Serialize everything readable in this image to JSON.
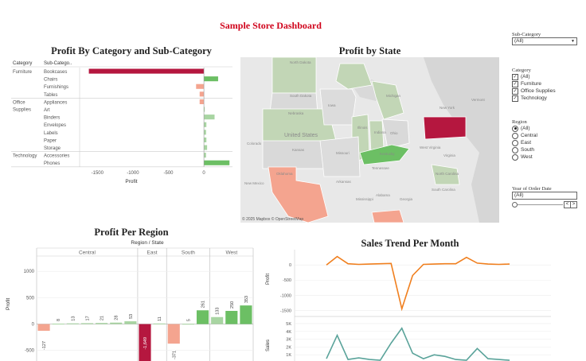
{
  "title": "Sample Store Dashboard",
  "colors": {
    "title": "#d0021b",
    "neg_dark": "#b5173f",
    "neg_light": "#f4a48f",
    "pos_light": "#a8d5a2",
    "pos_mid": "#6cbf64",
    "line_profit": "#f07f1e",
    "line_sales": "#5aa39a"
  },
  "category_chart": {
    "title": "Profit By Category and Sub-Category",
    "col_category": "Category",
    "col_subcategory": "Sub-Catego..",
    "x_axis_label": "Profit",
    "x_ticks": [
      "-1500",
      "-1000",
      "-500",
      "0"
    ],
    "groups": [
      {
        "category": "Furniture",
        "rows": [
          "Bookcases",
          "Chairs",
          "Furnishings",
          "Tables"
        ]
      },
      {
        "category": "Office Supplies",
        "rows": [
          "Appliances",
          "Art",
          "Binders",
          "Envelopes",
          "Labels",
          "Paper",
          "Storage"
        ]
      },
      {
        "category": "Technology",
        "rows": [
          "Accessories",
          "Phones"
        ]
      }
    ]
  },
  "chart_data": [
    {
      "type": "bar",
      "title": "Profit By Category and Sub-Category",
      "xlabel": "Profit",
      "xlim": [
        -1750,
        380
      ],
      "categories": [
        "Bookcases",
        "Chairs",
        "Furnishings",
        "Tables",
        "Appliances",
        "Art",
        "Binders",
        "Envelopes",
        "Labels",
        "Paper",
        "Storage",
        "Accessories",
        "Phones"
      ],
      "values": [
        -1620,
        200,
        -110,
        -60,
        -60,
        12,
        150,
        35,
        30,
        35,
        45,
        30,
        360
      ]
    },
    {
      "type": "bar",
      "title": "Profit Per Region",
      "xlabel": "Region / State",
      "ylabel": "Profit",
      "ylim": [
        -700,
        1350
      ],
      "regions": [
        "Central",
        "East",
        "South",
        "West"
      ],
      "values": [
        -127,
        8,
        13,
        17,
        21,
        28,
        53,
        -1649,
        11,
        -371,
        5,
        261,
        133,
        250,
        353
      ]
    },
    {
      "type": "line",
      "title": "Sales Trend Per Month",
      "series": [
        {
          "name": "Profit",
          "values": [
            0,
            280,
            40,
            20,
            30,
            40,
            50,
            -1450,
            -350,
            20,
            30,
            40,
            40,
            250,
            60,
            30,
            20,
            30
          ]
        },
        {
          "name": "Sales",
          "values": [
            500,
            3500,
            400,
            600,
            400,
            300,
            2500,
            4400,
            1200,
            500,
            1000,
            800,
            400,
            300,
            1800,
            500,
            400,
            300
          ]
        }
      ]
    }
  ],
  "map": {
    "title": "Profit by State",
    "attribution": "© 2025 Mapbox © OpenStreetMap",
    "labels": [
      "North Dakota",
      "South Dakota",
      "Iowa",
      "Nebraska",
      "United States",
      "Kansas",
      "Colorado",
      "Missouri",
      "Oklahoma",
      "Arkansas",
      "Tennessee",
      "Mississippi",
      "Alabama",
      "Georgia",
      "North Carolina",
      "South Carolina",
      "Virginia",
      "West Virginia",
      "Ohio",
      "New York",
      "Vermont",
      "Illinois",
      "Indiana",
      "Kentucky",
      "Michigan",
      "New Mexico"
    ]
  },
  "region_chart": {
    "title": "Profit Per Region",
    "header": "Region / State",
    "regions": [
      "Central",
      "East",
      "South",
      "West"
    ],
    "y_label": "Profit",
    "y_ticks": [
      "1000",
      "500",
      "0",
      "-500"
    ],
    "bar_labels": [
      "-127",
      "8",
      "13",
      "17",
      "21",
      "28",
      "53",
      "-1,649",
      "11",
      "-371",
      "5",
      "261",
      "133",
      "250",
      "353"
    ]
  },
  "trend_chart": {
    "title": "Sales Trend Per Month",
    "profit_label": "Profit",
    "sales_label": "Sales",
    "profit_ticks": [
      "0",
      "-500",
      "-1000",
      "-1500"
    ],
    "sales_ticks": [
      "5K",
      "4K",
      "3K",
      "2K",
      "1K"
    ]
  },
  "filters": {
    "subcategory": {
      "title": "Sub-Category",
      "value": "(All)"
    },
    "category": {
      "title": "Category",
      "options": [
        "(All)",
        "Furniture",
        "Office Supplies",
        "Technology"
      ]
    },
    "region": {
      "title": "Region",
      "options": [
        "(All)",
        "Central",
        "East",
        "South",
        "West"
      ],
      "selected": "(All)"
    },
    "year": {
      "title": "Year of Order Date",
      "value": "(All)"
    }
  }
}
